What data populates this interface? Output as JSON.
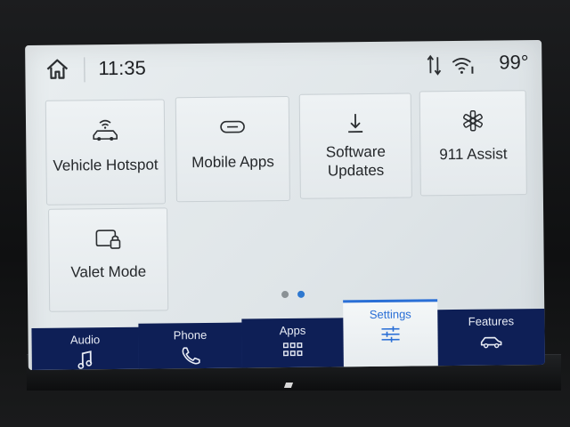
{
  "status": {
    "time": "11:35",
    "temperature": "99°",
    "icons": {
      "home": "home-icon",
      "sync": "data-sync-icon",
      "wifi": "wifi-icon"
    }
  },
  "tiles": [
    {
      "label": "Vehicle Hotspot",
      "icon": "car-wifi-icon"
    },
    {
      "label": "Mobile Apps",
      "icon": "link-icon"
    },
    {
      "label_line1": "Software",
      "label_line2": "Updates",
      "icon": "download-icon"
    },
    {
      "label": "911 Assist",
      "icon": "asterisk-icon"
    },
    {
      "label": "Valet Mode",
      "icon": "car-lock-icon"
    }
  ],
  "pagination": {
    "pages": 2,
    "current": 2
  },
  "nav": [
    {
      "label": "Audio",
      "icon": "music-note-icon"
    },
    {
      "label": "Phone",
      "icon": "phone-icon"
    },
    {
      "label": "Apps",
      "icon": "grid-icon"
    },
    {
      "label": "Settings",
      "icon": "sliders-icon",
      "active": true
    },
    {
      "label": "Features",
      "icon": "car-icon"
    }
  ],
  "colors": {
    "nav_bg": "#0e1f56",
    "accent": "#2a6fd6",
    "screen_bg": "#e6ebee"
  }
}
